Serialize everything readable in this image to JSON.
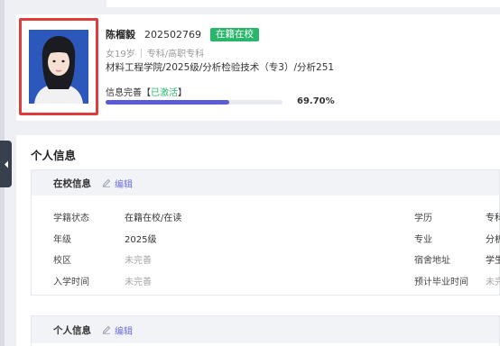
{
  "profile": {
    "name": "陈榴毅",
    "student_id": "202502769",
    "status_badge": "在籍在校",
    "gender_age": "女19岁",
    "level": "专科/高职专科",
    "college": "材料工程学院/2025级/分析检验技术（专3）/分析251",
    "info_label": "信息完善【",
    "info_active": "已激活",
    "info_close": "】",
    "progress_percent": 69.7,
    "progress_text": "69.70%"
  },
  "colors": {
    "badge_green": "#27b66a",
    "progress_purple": "#5b5bd6",
    "photo_frame_red": "#e03c3c",
    "link_purple": "#6d6fd9"
  },
  "personal": {
    "section_title": "个人信息",
    "school_panel": {
      "title": "在校信息",
      "edit_label": "编辑",
      "left_fields": [
        {
          "label": "学籍状态",
          "value": "在籍在校/在读"
        },
        {
          "label": "年级",
          "value": "2025级"
        },
        {
          "label": "校区",
          "value": "未完善"
        },
        {
          "label": "入学时间",
          "value": "未完善"
        }
      ],
      "right_fields": [
        {
          "label": "学历",
          "value": "专科"
        },
        {
          "label": "专业",
          "value": "分析"
        },
        {
          "label": "宿舍地址",
          "value": "学生"
        },
        {
          "label": "预计毕业时间",
          "value": "未完"
        }
      ]
    },
    "personal_panel": {
      "title": "个人信息",
      "edit_label": "编辑"
    }
  },
  "icons": {
    "collapse": "chevron-left-icon",
    "edit": "pencil-icon"
  }
}
